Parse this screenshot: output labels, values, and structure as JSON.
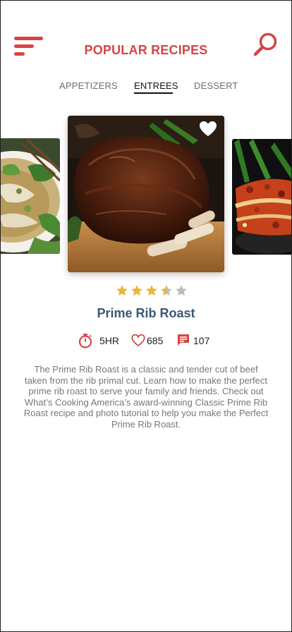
{
  "header": {
    "title": "POPULAR RECIPES",
    "menu_icon": "menu-icon",
    "search_icon": "search-icon"
  },
  "tabs": [
    {
      "label": "APPETIZERS",
      "active": false
    },
    {
      "label": "ENTREES",
      "active": true
    },
    {
      "label": "DESSERT",
      "active": false
    }
  ],
  "carousel": {
    "items": [
      {
        "image": "pho-soup-image"
      },
      {
        "image": "prime-rib-roast-image",
        "favorite_icon": "heart-icon"
      },
      {
        "image": "lasagna-image"
      }
    ]
  },
  "recipe": {
    "rating": 3.5,
    "rating_max": 5,
    "title": "Prime Rib Roast",
    "time": "5HR",
    "likes": "685",
    "comments": "107",
    "description": "The Prime Rib Roast is a classic and tender cut of beef taken from the rib primal cut.  Learn how to make the perfect prime rib roast to serve your family and friends.  Check out What’s Cooking America’s award-winning Classic Prime Rib Roast recipe and photo tutorial to help you make the Perfect Prime Rib Roast."
  },
  "colors": {
    "accent": "#d64545",
    "title_blue": "#3d5674",
    "star_filled": "#e6b83c",
    "star_empty": "#bdbdbd"
  }
}
